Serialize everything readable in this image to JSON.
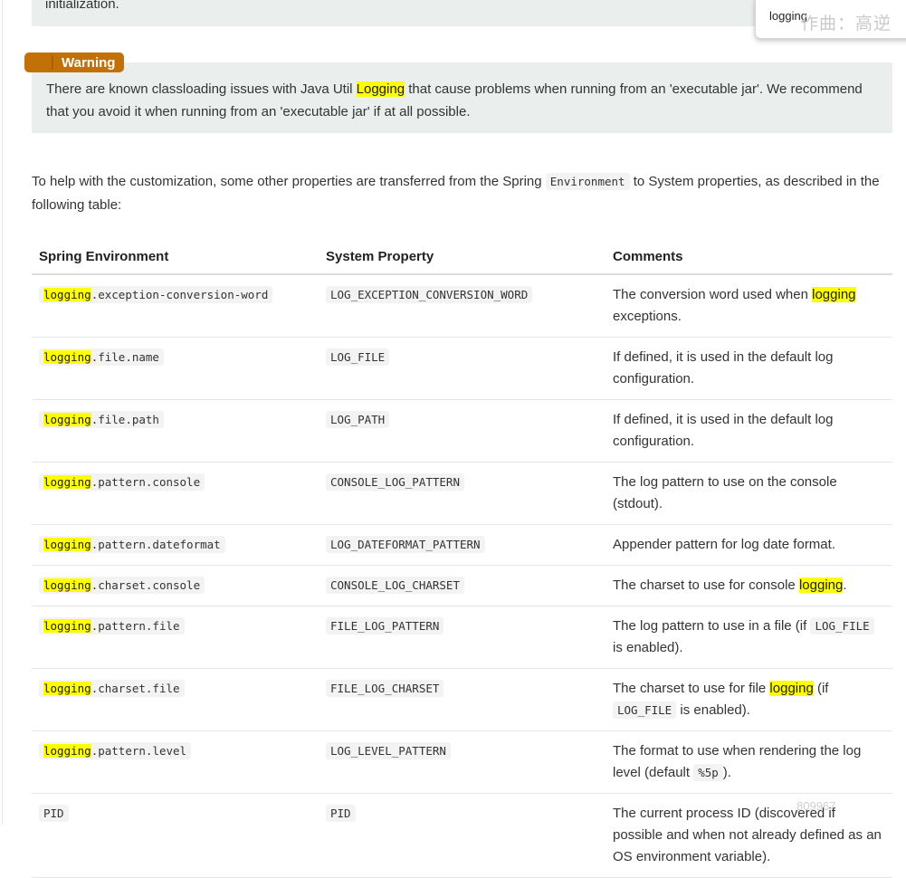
{
  "top_note": {
    "text": "initialization."
  },
  "search_popup": {
    "term": "logging",
    "watermark": "作曲：高逆"
  },
  "admonition": {
    "badge": "Warning",
    "text_before": "There are known classloading issues with Java Util ",
    "highlight": "Logging",
    "text_after": " that cause problems when running from an 'executable jar'. We recommend that you avoid it when running from an 'executable jar' if at all possible."
  },
  "intro": {
    "before": "To help with the customization, some other properties are transferred from the Spring ",
    "code": "Environment",
    "after": " to System properties, as described in the following table:"
  },
  "table": {
    "headers": [
      "Spring Environment",
      "System Property",
      "Comments"
    ],
    "highlight_word": "logging",
    "rows": [
      {
        "env_hl": "logging",
        "env_rest": ".exception-conversion-word",
        "sys": "LOG_EXCEPTION_CONVERSION_WORD",
        "c_before": "The conversion word used when ",
        "c_hl": "logging",
        "c_after": " exceptions."
      },
      {
        "env_hl": "logging",
        "env_rest": ".file.name",
        "sys": "LOG_FILE",
        "c_before": "If defined, it is used in the default log configuration."
      },
      {
        "env_hl": "logging",
        "env_rest": ".file.path",
        "sys": "LOG_PATH",
        "c_before": "If defined, it is used in the default log configuration."
      },
      {
        "env_hl": "logging",
        "env_rest": ".pattern.console",
        "sys": "CONSOLE_LOG_PATTERN",
        "c_before": "The log pattern to use on the console (stdout)."
      },
      {
        "env_hl": "logging",
        "env_rest": ".pattern.dateformat",
        "sys": "LOG_DATEFORMAT_PATTERN",
        "c_before": "Appender pattern for log date format."
      },
      {
        "env_hl": "logging",
        "env_rest": ".charset.console",
        "sys": "CONSOLE_LOG_CHARSET",
        "c_before": "The charset to use for console ",
        "c_hl": "logging",
        "c_after": "."
      },
      {
        "env_hl": "logging",
        "env_rest": ".pattern.file",
        "sys": "FILE_LOG_PATTERN",
        "c_before": "The log pattern to use in a file (if ",
        "c_code": "LOG_FILE",
        "c_after": " is enabled)."
      },
      {
        "env_hl": "logging",
        "env_rest": ".charset.file",
        "sys": "FILE_LOG_CHARSET",
        "c_before": "The charset to use for file ",
        "c_hl": "logging",
        "c_mid": " (if ",
        "c_code": "LOG_FILE",
        "c_after": " is enabled)."
      },
      {
        "env_hl": "logging",
        "env_rest": ".pattern.level",
        "sys": "LOG_LEVEL_PATTERN",
        "c_before": "The format to use when rendering the log level (default ",
        "c_code": "%5p",
        "c_after": ")."
      },
      {
        "env_hl": "",
        "env_rest": "PID",
        "sys": "PID",
        "c_before": "The current process ID (discovered if possible and when not already defined as an OS environment variable)."
      }
    ]
  },
  "corner_watermark": "809967"
}
